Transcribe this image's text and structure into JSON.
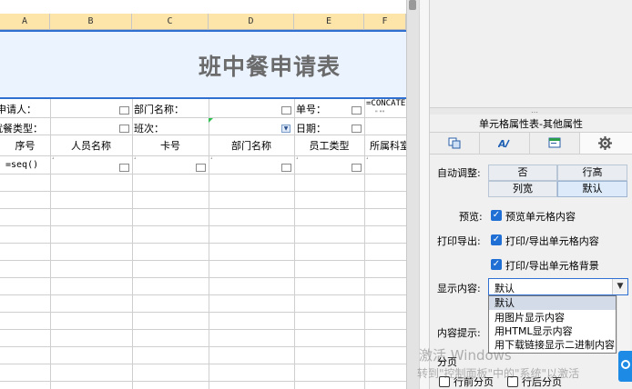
{
  "sheet": {
    "columns": [
      "A",
      "B",
      "C",
      "D",
      "E",
      "F"
    ],
    "title": "班中餐申请表",
    "row1": {
      "applicant_label": "申请人：",
      "dept_label": "部门名称：",
      "order_label": "单号：",
      "formula": "=CONCATE"
    },
    "row2": {
      "meal_type_label": "就餐类型：",
      "shift_label": "班次：",
      "date_label": "日期："
    },
    "headers": [
      "序号",
      "人员名称",
      "卡号",
      "部门名称",
      "员工类型",
      "所属科室"
    ],
    "first_data_cell": "=seq()"
  },
  "panel": {
    "title": "单元格属性表-其他属性",
    "tabs": [
      {
        "icon": "copy-cells-icon"
      },
      {
        "icon": "font-style-icon"
      },
      {
        "icon": "display-panel-icon"
      },
      {
        "icon": "gear-icon"
      }
    ],
    "auto_adjust_label": "自动调整:",
    "auto_adjust_options": [
      "否",
      "行高",
      "列宽",
      "默认"
    ],
    "auto_adjust_selected": "默认",
    "preview_label": "预览:",
    "preview_checkbox": "预览单元格内容",
    "print_export_label": "打印导出:",
    "print_content_checkbox": "打印/导出单元格内容",
    "print_bg_checkbox": "打印/导出单元格背景",
    "display_label": "显示内容:",
    "display_value": "默认",
    "display_options": [
      "默认",
      "用图片显示内容",
      "用HTML显示内容",
      "用下载链接显示二进制内容"
    ],
    "content_tip_label": "内容提示:",
    "paging_label": "分页",
    "before_page_checkbox": "行前分页",
    "after_page_checkbox": "行后分页"
  },
  "os_watermark": {
    "line1": "激活 Windows",
    "line2": "转到\"控制面板\"中的\"系统\"以激活"
  }
}
